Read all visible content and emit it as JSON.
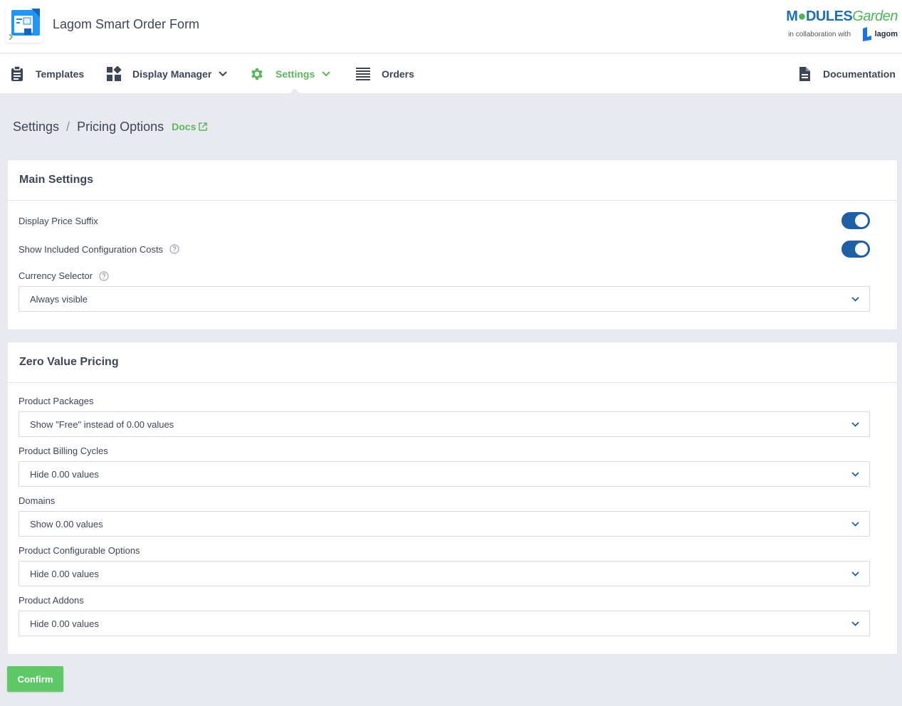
{
  "app": {
    "title": "Lagom Smart Order Form",
    "brand": {
      "part1": "M",
      "part2": "DULES",
      "part3": "Garden",
      "collab": "in collaboration with",
      "partner": "lagom"
    }
  },
  "nav": {
    "items": [
      {
        "label": "Templates",
        "icon": "clipboard-icon",
        "dropdown": false
      },
      {
        "label": "Display Manager",
        "icon": "widgets-icon",
        "dropdown": true
      },
      {
        "label": "Settings",
        "icon": "gear-icon",
        "dropdown": true,
        "active": true
      },
      {
        "label": "Orders",
        "icon": "list-icon",
        "dropdown": false
      }
    ],
    "documentation": "Documentation"
  },
  "breadcrumb": {
    "items": [
      "Settings",
      "Pricing Options"
    ],
    "separator": "/",
    "docs": "Docs"
  },
  "main_settings": {
    "title": "Main Settings",
    "display_price_suffix": {
      "label": "Display Price Suffix",
      "value": true
    },
    "show_included_config_costs": {
      "label": "Show Included Configuration Costs",
      "value": true
    },
    "currency_selector": {
      "label": "Currency Selector",
      "value": "Always visible"
    }
  },
  "zero_value_pricing": {
    "title": "Zero Value Pricing",
    "fields": [
      {
        "label": "Product Packages",
        "value": "Show \"Free\" instead of 0.00 values"
      },
      {
        "label": "Product Billing Cycles",
        "value": "Hide 0.00 values"
      },
      {
        "label": "Domains",
        "value": "Show 0.00 values"
      },
      {
        "label": "Product Configurable Options",
        "value": "Hide 0.00 values"
      },
      {
        "label": "Product Addons",
        "value": "Hide 0.00 values"
      }
    ]
  },
  "actions": {
    "confirm": "Confirm"
  },
  "colors": {
    "accent_green": "#5cb85c",
    "toggle_blue": "#1d5fa8",
    "background": "#e8eaef"
  }
}
